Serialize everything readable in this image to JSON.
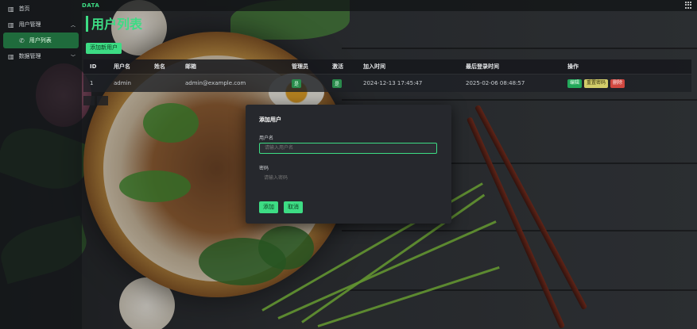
{
  "brand": "DATA",
  "sidebar": {
    "items": [
      {
        "label": "首页",
        "icon": "chart-bar-icon"
      },
      {
        "label": "用户管理",
        "icon": "chart-bar-icon",
        "expanded": true
      },
      {
        "label": "用户列表",
        "icon": "phone-icon",
        "active": true
      },
      {
        "label": "数据管理",
        "icon": "chart-bar-icon",
        "expanded": false
      }
    ]
  },
  "page": {
    "title": "用户列表",
    "add_button": "添加新用户"
  },
  "table": {
    "headers": [
      "ID",
      "用户名",
      "姓名",
      "邮箱",
      "管理员",
      "激活",
      "加入时间",
      "最后登录时间",
      "操作"
    ],
    "rows": [
      {
        "id": "1",
        "username": "admin",
        "name": "",
        "email": "admin@example.com",
        "admin": "是",
        "active": "是",
        "joined": "2024-12-13 17:45:47",
        "last_login": "2025-02-06 08:48:57",
        "actions": [
          "编辑",
          "重置密码",
          "删除"
        ]
      }
    ]
  },
  "modal": {
    "title": "添加用户",
    "username_label": "用户名",
    "username_placeholder": "请输入用户名",
    "password_label": "密码",
    "password_placeholder": "请输入密码",
    "add_button": "添加",
    "cancel_button": "取消"
  },
  "colors": {
    "accent": "#3ddc84",
    "edit": "#22a85a",
    "reset": "#d2cd6a",
    "delete": "#d0473f"
  }
}
